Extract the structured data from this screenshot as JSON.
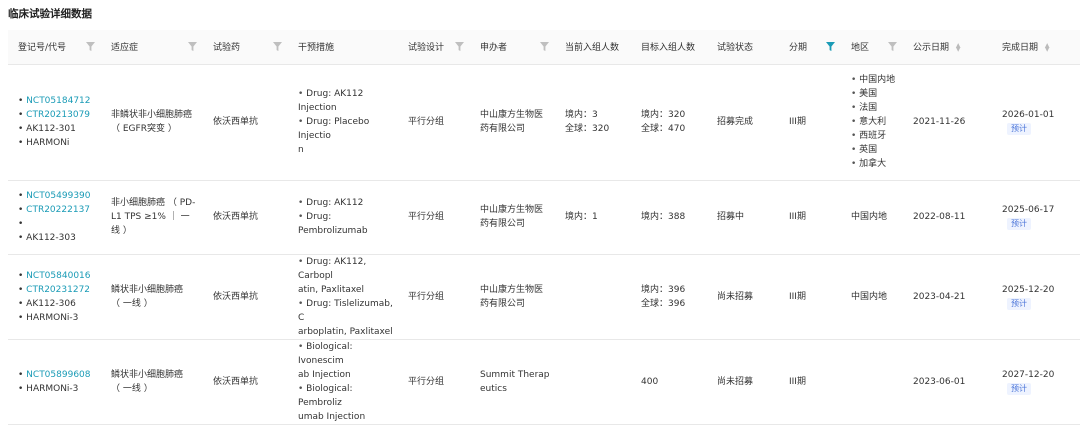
{
  "page": {
    "title": "临床试验详细数据"
  },
  "headers": {
    "reg_id": "登记号/代号",
    "indication": "适应症",
    "drug": "试验药",
    "intervention": "干预措施",
    "design": "试验设计",
    "sponsor": "申办者",
    "current_enroll": "当前入组人数",
    "target_enroll": "目标入组人数",
    "status": "试验状态",
    "phase": "分期",
    "region": "地区",
    "pub_date": "公示日期",
    "end_date": "完成日期"
  },
  "rows": [
    {
      "ids": [
        "NCT05184712",
        "CTR20213079",
        "AK112-301",
        "HARMONi"
      ],
      "indication": [
        "非鳞状非小细胞肺癌",
        "（ EGFR突变 ）"
      ],
      "drug": "依沃西单抗",
      "interventions": [
        "Drug: AK112 Injection",
        "Drug: Placebo Injectio",
        "n"
      ],
      "design": "平行分组",
      "sponsor": [
        "中山康方生物医",
        "药有限公司"
      ],
      "current": [
        "境内：3",
        "全球：320"
      ],
      "target": [
        "境内：320",
        "全球：470"
      ],
      "status": "招募完成",
      "phase": "III期",
      "region": [
        "中国内地",
        "美国",
        "法国",
        "意大利",
        "西班牙",
        "英国",
        "加拿大"
      ],
      "pub_date": "2021-11-26",
      "end_date": "2026-01-01",
      "end_tag": "预计"
    },
    {
      "ids": [
        "NCT05499390",
        "CTR20222137",
        "",
        "AK112-303"
      ],
      "indication": [
        "非小细胞肺癌 （ PD-",
        "L1 TPS ≥1% ｜ 一",
        "线 ）"
      ],
      "drug": "依沃西单抗",
      "interventions": [
        "Drug: AK112",
        "Drug: Pembrolizumab"
      ],
      "design": "平行分组",
      "sponsor": [
        "中山康方生物医",
        "药有限公司"
      ],
      "current": [
        "境内：1"
      ],
      "target": [
        "境内：388"
      ],
      "status": "招募中",
      "phase": "III期",
      "region_text": "中国内地",
      "pub_date": "2022-08-11",
      "end_date": "2025-06-17",
      "end_tag": "预计"
    },
    {
      "ids": [
        "NCT05840016",
        "CTR20231272",
        "AK112-306",
        "HARMONi-3"
      ],
      "indication": [
        "鳞状非小细胞肺癌",
        "（ 一线 ）"
      ],
      "drug": "依沃西单抗",
      "interventions": [
        "Drug: AK112, Carbopl",
        "atin, Paxlitaxel",
        "Drug: Tislelizumab, C",
        "arboplatin, Paxlitaxel"
      ],
      "design": "平行分组",
      "sponsor": [
        "中山康方生物医",
        "药有限公司"
      ],
      "current": [],
      "target": [
        "境内：396",
        "全球：396"
      ],
      "status": "尚未招募",
      "phase": "III期",
      "region_text": "中国内地",
      "pub_date": "2023-04-21",
      "end_date": "2025-12-20",
      "end_tag": "预计"
    },
    {
      "ids": [
        "NCT05899608",
        "HARMONi-3"
      ],
      "indication": [
        "鳞状非小细胞肺癌",
        "（ 一线 ）"
      ],
      "drug": "依沃西单抗",
      "interventions": [
        "Biological: Ivonescim",
        "ab Injection",
        "Biological: Pembroliz",
        "umab Injection"
      ],
      "design": "平行分组",
      "sponsor": [
        "Summit Therap",
        "eutics"
      ],
      "current": [],
      "target": [
        "400"
      ],
      "status": "尚未招募",
      "phase": "III期",
      "region_text": "",
      "pub_date": "2023-06-01",
      "end_date": "2027-12-20",
      "end_tag": "预计"
    }
  ],
  "colors": {
    "link": "#1a9bb6",
    "active_filter": "#1a9bb6",
    "tag_bg": "#eef3ff",
    "tag_text": "#4a74d8"
  },
  "icons": {
    "filter": "funnel-icon",
    "sort": "sort-caret-icon"
  }
}
